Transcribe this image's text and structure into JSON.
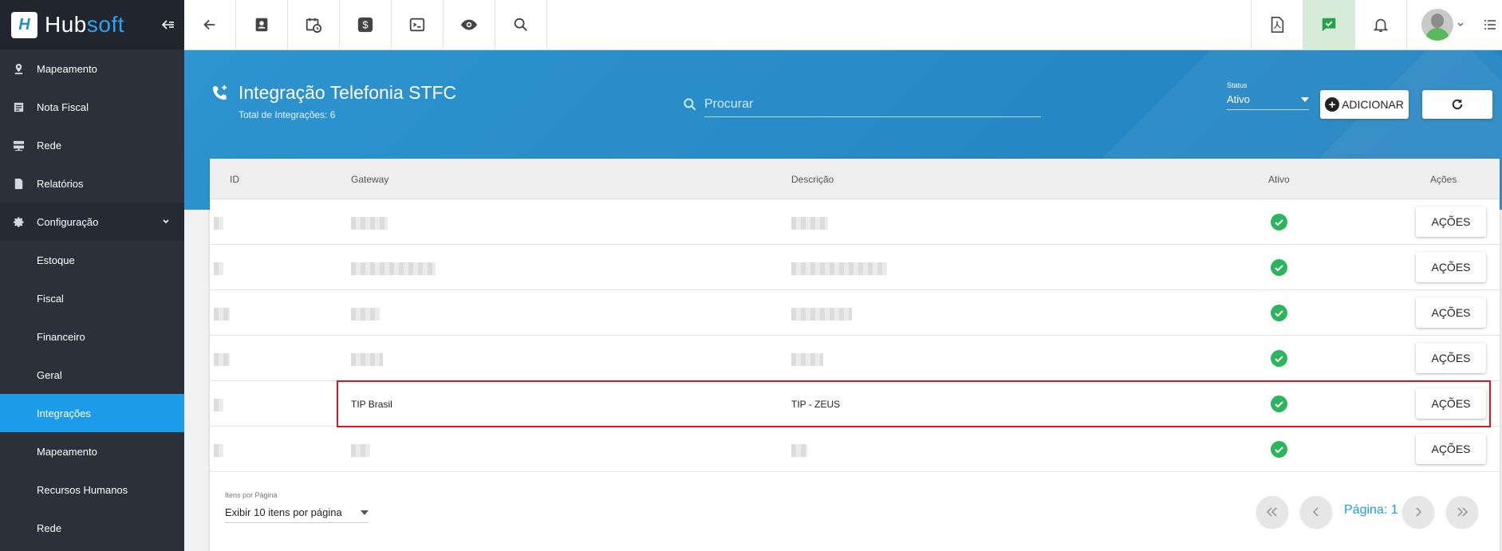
{
  "app": {
    "logo_hub": "Hub",
    "logo_soft": "soft",
    "logo_mark": "H"
  },
  "sidebar": {
    "items": [
      {
        "label": "Mapeamento",
        "icon": "map-marker-icon"
      },
      {
        "label": "Nota Fiscal",
        "icon": "receipt-icon"
      },
      {
        "label": "Rede",
        "icon": "server-icon"
      },
      {
        "label": "Relatórios",
        "icon": "document-icon"
      },
      {
        "label": "Configuração",
        "icon": "gear-icon"
      }
    ],
    "subitems": [
      {
        "label": "Estoque"
      },
      {
        "label": "Fiscal"
      },
      {
        "label": "Financeiro"
      },
      {
        "label": "Geral"
      },
      {
        "label": "Integrações",
        "active": true
      },
      {
        "label": "Mapeamento"
      },
      {
        "label": "Recursos Humanos"
      },
      {
        "label": "Rede"
      }
    ]
  },
  "topbar": {
    "left_icons": [
      "back-arrow-icon",
      "contact-card-icon",
      "calendar-clock-icon",
      "dollar-icon",
      "terminal-icon",
      "eye-icon",
      "search-icon"
    ],
    "right_icons": [
      "pdf-icon",
      "chat-check-icon",
      "bell-icon"
    ]
  },
  "header": {
    "title": "Integração Telefonia STFC",
    "subtitle": "Total de Integrações: 6",
    "search_placeholder": "Procurar",
    "status_label": "Status",
    "status_value": "Ativo",
    "add_label": "ADICIONAR"
  },
  "table": {
    "columns": [
      "ID",
      "Gateway",
      "Descrição",
      "Ativo",
      "Ações"
    ],
    "rows": [
      {
        "gateway": "",
        "descricao": "",
        "ativo": true,
        "acoes": "AÇÕES"
      },
      {
        "gateway": "",
        "descricao": "",
        "ativo": true,
        "acoes": "AÇÕES"
      },
      {
        "gateway": "",
        "descricao": "",
        "ativo": true,
        "acoes": "AÇÕES"
      },
      {
        "gateway": "",
        "descricao": "",
        "ativo": true,
        "acoes": "AÇÕES"
      },
      {
        "gateway": "TIP Brasil",
        "descricao": "TIP - ZEUS",
        "ativo": true,
        "acoes": "AÇÕES"
      },
      {
        "gateway": "",
        "descricao": "",
        "ativo": true,
        "acoes": "AÇÕES"
      }
    ],
    "highlight_color": "#e3151a"
  },
  "footer": {
    "perpage_label": "Itens por Página",
    "perpage_value": "Exibir 10 itens por página",
    "page_label": "Página: 1"
  },
  "colors": {
    "accent": "#1b9be8",
    "header_band": "#2d94cf",
    "sidebar": "#2b3039",
    "active_check": "#2db55d"
  }
}
